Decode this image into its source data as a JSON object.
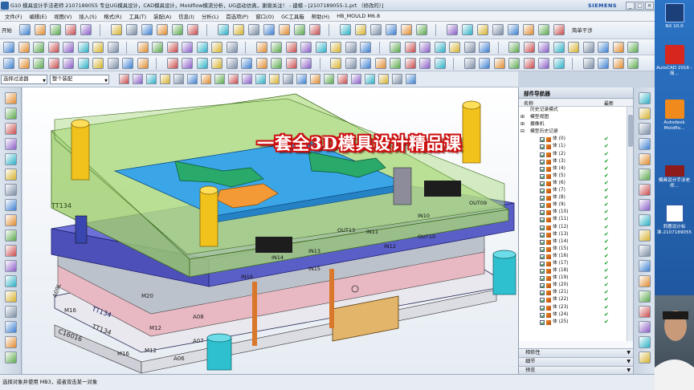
{
  "window": {
    "title": "G10 模具设计手法老师 2107189055 专业UG模具设计，CAD模具设计，Moldflow模流分析，UG运动仿真，谢谢关注！ - 建模 - [2107189055-1.prt （修改的）]",
    "brand": "SIEMENS",
    "min_label": "_",
    "max_label": "□",
    "close_label": "×"
  },
  "menu": {
    "items": [
      "文件(F)",
      "编辑(E)",
      "视图(V)",
      "插入(S)",
      "格式(R)",
      "工具(T)",
      "装配(A)",
      "信息(I)",
      "分析(L)",
      "首选项(P)",
      "窗口(O)",
      "GC工具箱",
      "帮助(H)",
      "HB_MOULD M6.8"
    ]
  },
  "toolbar": {
    "start_label": "开始",
    "reset_label": "简单干涉"
  },
  "selection": {
    "filter": "选择过滤器",
    "scope": "整个装配"
  },
  "viewport": {
    "watermark": "一套全3D模具设计精品课",
    "labels": [
      "TT134",
      "A09L",
      "M16",
      "TT134",
      "TT134",
      "C16016",
      "M12",
      "M12",
      "M16",
      "M20",
      "A08",
      "A07",
      "A06",
      "IN16",
      "IN15",
      "IN13",
      "OUT13",
      "IN11",
      "OUT10",
      "IN10",
      "OUT09",
      "IN14",
      "IN12"
    ]
  },
  "navigator": {
    "title": "部件导航器",
    "col_name": "名称",
    "col_latest": "最新",
    "history_mode": "历史记录模式",
    "model_views": "模型视图",
    "camera": "摄像机",
    "model_history": "模型历史记录",
    "bodies": [
      "体 (0)",
      "体 (1)",
      "体 (2)",
      "体 (3)",
      "体 (4)",
      "体 (5)",
      "体 (6)",
      "体 (7)",
      "体 (8)",
      "体 (9)",
      "体 (10)",
      "体 (11)",
      "体 (12)",
      "体 (13)",
      "体 (14)",
      "体 (15)",
      "体 (16)",
      "体 (17)",
      "体 (18)",
      "体 (19)",
      "体 (20)",
      "体 (21)",
      "体 (22)",
      "体 (23)",
      "体 (24)",
      "体 (25)"
    ],
    "check_mark": "✔",
    "panel_deps": "相依性",
    "panel_details": "细节",
    "panel_preview": "预览"
  },
  "status": {
    "text": "选择对象并使用 MB3，或者双击某一对象"
  },
  "desktop": {
    "nx_label": "NX 10.0",
    "autocad_label": "AutoCAD 2016 - 简...",
    "moldflow_label": "Autodesk Moldflo...",
    "doc1_label": "模具设计手法老师...",
    "doc2_label": "莉惠设计标准-2107189055"
  },
  "colors": {
    "accent": "#104aa0",
    "watermark_outline": "#cc1010",
    "check_green": "#0a9a1b",
    "plate_green": "#a9d67a",
    "plate_blue": "#5a5fc8",
    "cavity_blue": "#3aa6e8",
    "guide_yellow": "#f1c21b"
  }
}
